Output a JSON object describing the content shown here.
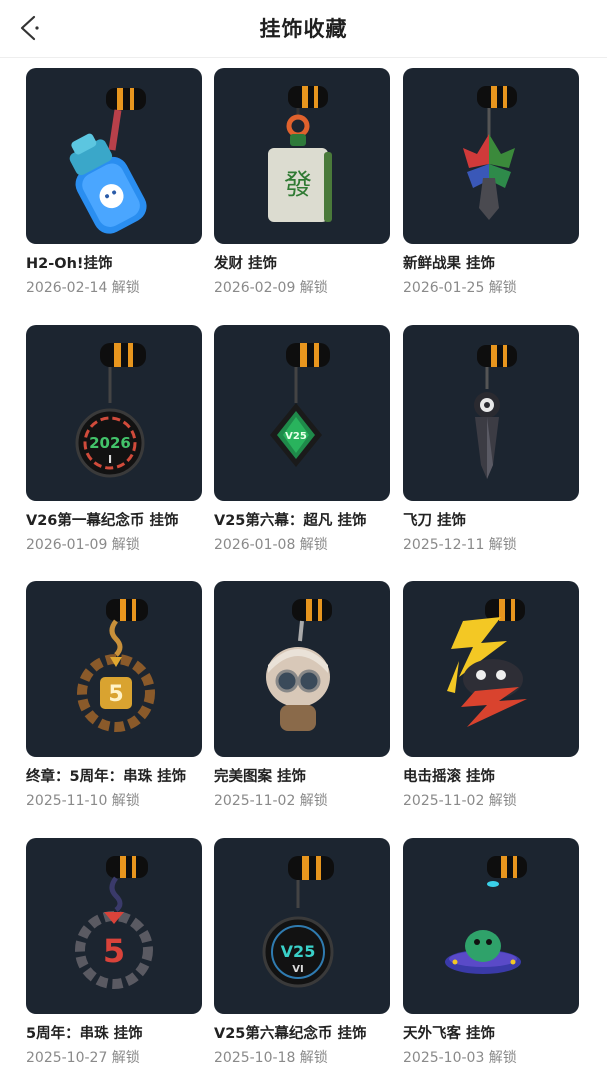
{
  "header": {
    "title": "挂饰收藏"
  },
  "items": [
    {
      "name": "H2-Oh!挂饰",
      "date": "2026-02-14 解锁",
      "icon": "water-bottle-charm-icon"
    },
    {
      "name": "发财 挂饰",
      "date": "2026-02-09 解锁",
      "icon": "mahjong-tile-charm-icon"
    },
    {
      "name": "新鲜战果 挂饰",
      "date": "2026-01-25 解锁",
      "icon": "fruit-leaf-charm-icon"
    },
    {
      "name": "V26第一幕纪念币 挂饰",
      "date": "2026-01-09 解锁",
      "icon": "v26-coin-charm-icon"
    },
    {
      "name": "V25第六幕：超凡 挂饰",
      "date": "2026-01-08 解锁",
      "icon": "v25-diamond-charm-icon"
    },
    {
      "name": "飞刀 挂饰",
      "date": "2025-12-11 解锁",
      "icon": "kunai-charm-icon"
    },
    {
      "name": "终章：5周年：串珠 挂饰",
      "date": "2025-11-10 解锁",
      "icon": "gold-5-bead-ring-charm-icon"
    },
    {
      "name": "完美图案 挂饰",
      "date": "2025-11-02 解锁",
      "icon": "goggles-character-charm-icon"
    },
    {
      "name": "电击摇滚 挂饰",
      "date": "2025-11-02 解锁",
      "icon": "lightning-critter-charm-icon"
    },
    {
      "name": "5周年：串珠 挂饰",
      "date": "2025-10-27 解锁",
      "icon": "red-5-bead-ring-charm-icon"
    },
    {
      "name": "V25第六幕纪念币 挂饰",
      "date": "2025-10-18 解锁",
      "icon": "v25-coin-charm-icon"
    },
    {
      "name": "天外飞客 挂饰",
      "date": "2025-10-03 解锁",
      "icon": "ufo-charm-icon"
    }
  ]
}
